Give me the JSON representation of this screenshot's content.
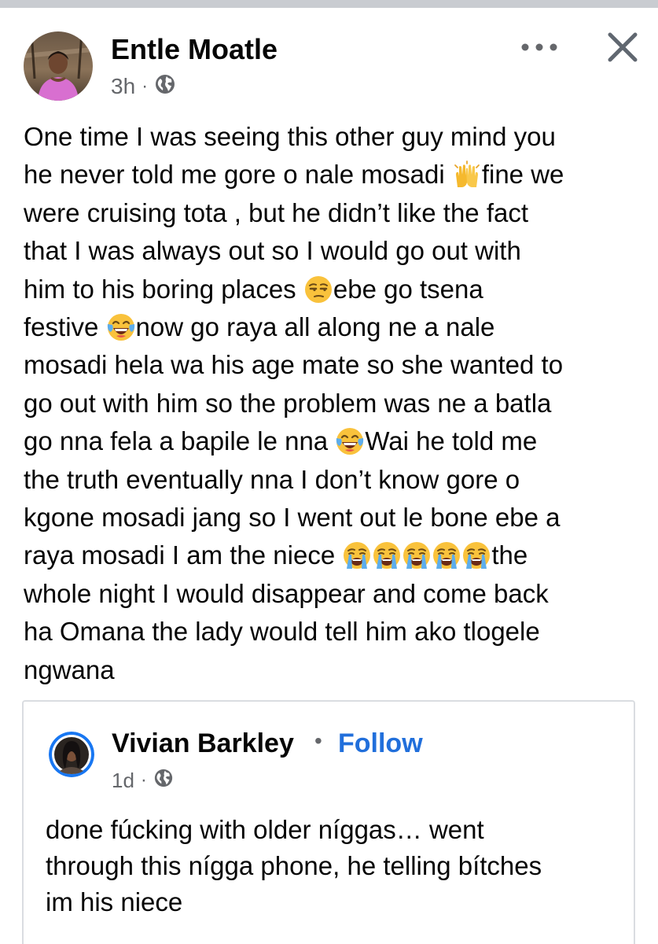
{
  "post": {
    "author": "Entle Moatle",
    "time": "3h",
    "separator": "·",
    "privacy_icon": "globe-icon",
    "more_icon": "more-horizontal-icon",
    "close_icon": "close-icon",
    "body_lines": [
      [
        "One time I was seeing this other guy mind you"
      ],
      [
        "he never told me gore o nale mosadi ",
        "🙌",
        "fine we"
      ],
      [
        "were cruising tota , but he didn’t like the fact"
      ],
      [
        "that I was always out so I would go out with"
      ],
      [
        "him to his boring places ",
        "😒",
        "ebe go tsena"
      ],
      [
        "festive ",
        "😂",
        "now go raya all along ne a nale"
      ],
      [
        "mosadi hela wa his age mate so she wanted to"
      ],
      [
        "go out with him so the problem was ne a batla"
      ],
      [
        "go nna fela a bapile le nna ",
        "😂",
        "Wai he told me"
      ],
      [
        "the truth eventually nna I don’t know gore o"
      ],
      [
        "kgone mosadi jang so I went out le bone ebe a"
      ],
      [
        "raya mosadi I am the niece ",
        "😭",
        "😭",
        "😭",
        "😭",
        "😭",
        "the"
      ],
      [
        "whole night I would disappear and come back"
      ],
      [
        "ha Omana the lady would tell him ako tlogele"
      ],
      [
        "ngwana"
      ]
    ]
  },
  "shared": {
    "author": "Vivian Barkley",
    "bullet": "•",
    "follow_label": "Follow",
    "time": "1d",
    "separator": "·",
    "privacy_icon": "globe-icon",
    "text_lines": [
      "done fúcking with older níggas… went",
      "through this nígga phone, he telling bítches",
      "im his niece"
    ]
  },
  "colors": {
    "link_blue": "#216fdb",
    "secondary_text": "#65676b",
    "border": "#dadde1",
    "top_strip": "#c9ccd1"
  }
}
